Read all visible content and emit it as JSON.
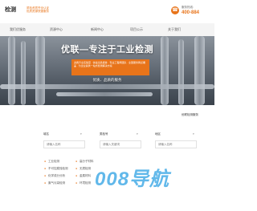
{
  "header": {
    "logo_text": "检测",
    "slogan_line1": "质检资质齐全认证",
    "slogan_line2": "优质资源快速服务",
    "phone_label": "服务热线:",
    "phone_number": "400-884"
  },
  "nav": {
    "items": [
      "我们优服务",
      "资源中心",
      "新闻中心",
      "项目公示",
      "关于我们"
    ]
  },
  "banner": {
    "title": "优联—专注于工业检测",
    "description": "资质齐全实验室 · 快速出具报告 · 专业工程师团队 · 全国服务网点覆盖 · 为企业提供一站式检测解决方案",
    "subtitle": "优质、品质的服务"
  },
  "filter": {
    "caption": "优联检测服务",
    "label_1": "城名",
    "label_2": "类检号",
    "label_3": "地区",
    "arrow": "▾",
    "placeholder_1": "请输入名称",
    "placeholder_2": "请输入关键词",
    "placeholder_3": "请输入名称"
  },
  "categories": [
    [
      "工业检测",
      "高分子材料"
    ],
    [
      "不可控腐蚀检测",
      "无损检测"
    ],
    [
      "化学成分分析",
      "金属材料"
    ],
    [
      "废气污染检测",
      "环境检测"
    ]
  ],
  "watermark": "008导航",
  "colors": {
    "accent": "#e8741a",
    "watermark": "#3aa7e5"
  },
  "icons": {
    "phone": "phone-icon"
  }
}
